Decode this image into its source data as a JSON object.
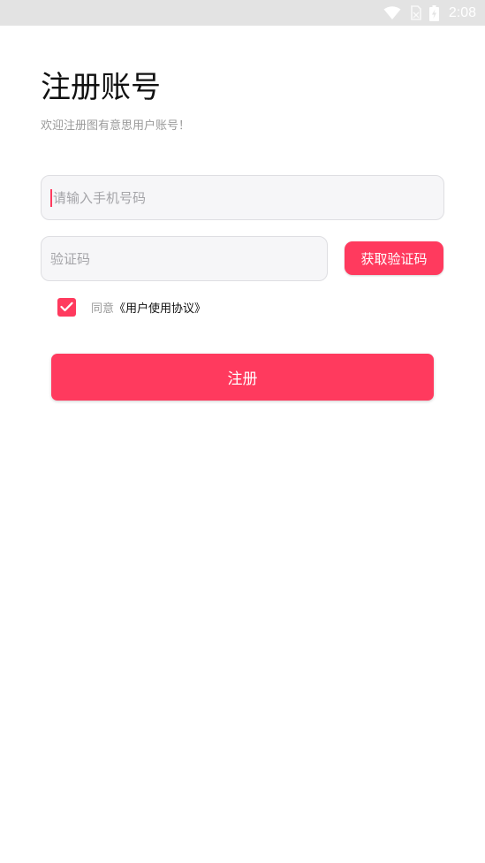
{
  "status_bar": {
    "time": "2:08",
    "icons": [
      "wifi-icon",
      "sim-no-signal-icon",
      "battery-charging-icon"
    ]
  },
  "header": {
    "title": "注册账号",
    "subtitle": "欢迎注册图有意思用户账号！"
  },
  "form": {
    "phone_placeholder": "请输入手机号码",
    "code_placeholder": "验证码",
    "get_code_label": "获取验证码",
    "agree_prefix": "同意",
    "agreement_link": "《用户使用协议》",
    "agree_checked": true,
    "register_label": "注册"
  },
  "colors": {
    "accent": "#ff3a5e",
    "status_bar_bg": "#e3e3e3",
    "field_bg": "#f6f6f8"
  }
}
